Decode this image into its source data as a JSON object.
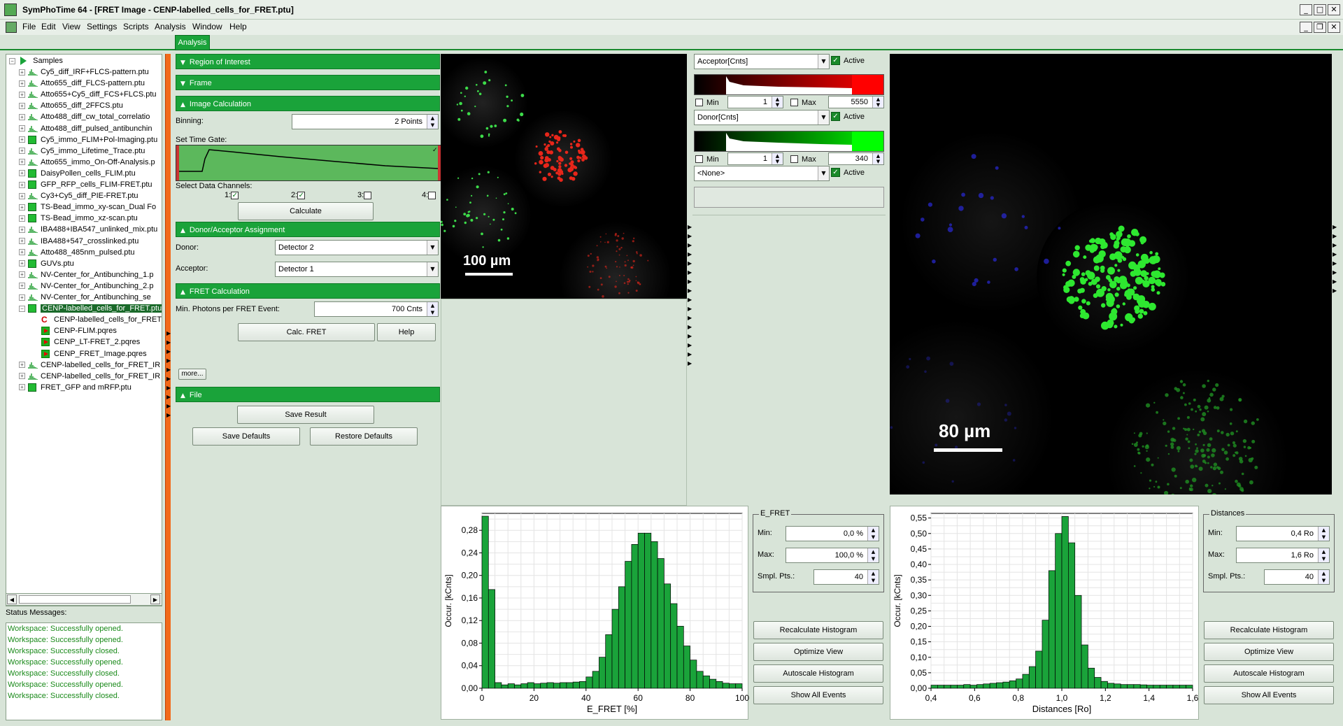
{
  "window": {
    "title": "SymPhoTime 64 - [FRET Image - CENP-labelled_cells_for_FRET.ptu]"
  },
  "menu": [
    "File",
    "Edit",
    "View",
    "Settings",
    "Scripts",
    "Analysis",
    "Window",
    "Help"
  ],
  "tabs": {
    "active": "Analysis"
  },
  "tree": {
    "root": "Samples",
    "items": [
      {
        "label": "Cy5_diff_IRF+FLCS-pattern.ptu",
        "icon": "bar"
      },
      {
        "label": "Atto655_diff_FLCS-pattern.ptu",
        "icon": "bar"
      },
      {
        "label": "Atto655+Cy5_diff_FCS+FLCS.ptu",
        "icon": "bar"
      },
      {
        "label": "Atto655_diff_2FFCS.ptu",
        "icon": "bar"
      },
      {
        "label": "Atto488_diff_cw_total_correlatio",
        "icon": "bar"
      },
      {
        "label": "Atto488_diff_pulsed_antibunchin",
        "icon": "bar"
      },
      {
        "label": "Cy5_immo_FLIM+Pol-Imaging.ptu",
        "icon": "square"
      },
      {
        "label": "Cy5_immo_Lifetime_Trace.ptu",
        "icon": "bar"
      },
      {
        "label": "Atto655_immo_On-Off-Analysis.p",
        "icon": "bar"
      },
      {
        "label": "DaisyPollen_cells_FLIM.ptu",
        "icon": "square"
      },
      {
        "label": "GFP_RFP_cells_FLIM-FRET.ptu",
        "icon": "square"
      },
      {
        "label": "Cy3+Cy5_diff_PIE-FRET.ptu",
        "icon": "bar"
      },
      {
        "label": "TS-Bead_immo_xy-scan_Dual Fo",
        "icon": "square"
      },
      {
        "label": "TS-Bead_immo_xz-scan.ptu",
        "icon": "square"
      },
      {
        "label": "IBA488+IBA547_unlinked_mix.ptu",
        "icon": "bar"
      },
      {
        "label": "IBA488+547_crosslinked.ptu",
        "icon": "bar"
      },
      {
        "label": "Atto488_485nm_pulsed.ptu",
        "icon": "bar"
      },
      {
        "label": "GUVs.ptu",
        "icon": "square"
      },
      {
        "label": "NV-Center_for_Antibunching_1.p",
        "icon": "bar"
      },
      {
        "label": "NV-Center_for_Antibunching_2.p",
        "icon": "bar"
      },
      {
        "label": "NV-Center_for_Antibunching_se",
        "icon": "bar"
      },
      {
        "label": "CENP-labelled_cells_for_FRET.ptu",
        "icon": "square",
        "selected": true
      },
      {
        "label": "CENP-labelled_cells_for_FRET",
        "icon": "c",
        "child": true
      },
      {
        "label": "CENP-FLIM.pqres",
        "icon": "pq",
        "child": true
      },
      {
        "label": "CENP_LT-FRET_2.pqres",
        "icon": "pq",
        "child": true
      },
      {
        "label": "CENP_FRET_Image.pqres",
        "icon": "pq",
        "child": true
      },
      {
        "label": "CENP-labelled_cells_for_FRET_IR",
        "icon": "bar"
      },
      {
        "label": "CENP-labelled_cells_for_FRET_IR",
        "icon": "bar"
      },
      {
        "label": "FRET_GFP and mRFP.ptu",
        "icon": "square"
      }
    ]
  },
  "status": {
    "label": "Status Messages:",
    "messages": [
      "Workspace: Successfully opened.",
      "Workspace: Successfully opened.",
      "Workspace: Successfully closed.",
      "Workspace: Successfully opened.",
      "Workspace: Successfully closed.",
      "Workspace: Successfully opened.",
      "Workspace: Successfully closed."
    ]
  },
  "panel": {
    "sec_roi": "Region of Interest",
    "sec_frame": "Frame",
    "sec_imgcalc": "Image Calculation",
    "binning_label": "Binning:",
    "binning_value": "2 Points",
    "timegate_label": "Set Time Gate:",
    "channels_label": "Select Data Channels:",
    "channels": [
      {
        "label": "1:",
        "checked": true
      },
      {
        "label": "2:",
        "checked": true
      },
      {
        "label": "3:",
        "checked": false
      },
      {
        "label": "4:",
        "checked": false
      }
    ],
    "calculate": "Calculate",
    "sec_da": "Donor/Acceptor Assignment",
    "donor_label": "Donor:",
    "donor_value": "Detector 2",
    "acceptor_label": "Acceptor:",
    "acceptor_value": "Detector 1",
    "sec_fret": "FRET Calculation",
    "minphot_label": "Min. Photons per FRET Event:",
    "minphot_value": "700 Cnts",
    "calc_fret": "Calc. FRET",
    "help": "Help",
    "more": "more...",
    "sec_file": "File",
    "save_result": "Save Result",
    "save_defaults": "Save Defaults",
    "restore_defaults": "Restore Defaults"
  },
  "image1": {
    "scalebar": "100 µm"
  },
  "image2": {
    "scalebar": "80 µm"
  },
  "lut": {
    "acceptor": {
      "channel": "Acceptor[Cnts]",
      "active": "Active",
      "min_label": "Min",
      "min_value": "1",
      "max_label": "Max",
      "max_value": "5550",
      "color": "#ff0000"
    },
    "donor": {
      "channel": "Donor[Cnts]",
      "active": "Active",
      "min_label": "Min",
      "min_value": "1",
      "max_label": "Max",
      "max_value": "340",
      "color": "#00ff00"
    },
    "third": {
      "channel": "<None>",
      "active": "Active"
    }
  },
  "fret_hist": {
    "group": "E_FRET",
    "min_label": "Min:",
    "min_value": "0,0 %",
    "max_label": "Max:",
    "max_value": "100,0 %",
    "pts_label": "Smpl. Pts.:",
    "pts_value": "40",
    "buttons": [
      "Recalculate Histogram",
      "Optimize View",
      "Autoscale Histogram",
      "Show All Events"
    ]
  },
  "dist_hist": {
    "group": "Distances",
    "min_label": "Min:",
    "min_value": "0,4 Ro",
    "max_label": "Max:",
    "max_value": "1,6 Ro",
    "pts_label": "Smpl. Pts.:",
    "pts_value": "40",
    "buttons": [
      "Recalculate Histogram",
      "Optimize View",
      "Autoscale Histogram",
      "Show All Events"
    ]
  },
  "chart_data": [
    {
      "type": "bar",
      "xlabel": "E_FRET [%]",
      "ylabel": "Occur. [kCnts]",
      "xlim": [
        0,
        100
      ],
      "ylim": [
        0,
        0.31
      ],
      "xticks": [
        "0",
        "20",
        "40",
        "60",
        "80",
        "100"
      ],
      "yticks": [
        "0,00",
        "0,04",
        "0,08",
        "0,12",
        "0,16",
        "0,20",
        "0,24",
        "0,28"
      ],
      "bar_width": 2.5,
      "x": [
        0,
        2.5,
        5,
        7.5,
        10,
        12.5,
        15,
        17.5,
        20,
        22.5,
        25,
        27.5,
        30,
        32.5,
        35,
        37.5,
        40,
        42.5,
        45,
        47.5,
        50,
        52.5,
        55,
        57.5,
        60,
        62.5,
        65,
        67.5,
        70,
        72.5,
        75,
        77.5,
        80,
        82.5,
        85,
        87.5,
        90,
        92.5,
        95,
        97.5
      ],
      "values": [
        0.305,
        0.175,
        0.01,
        0.006,
        0.008,
        0.006,
        0.008,
        0.01,
        0.008,
        0.009,
        0.01,
        0.009,
        0.01,
        0.01,
        0.011,
        0.012,
        0.02,
        0.03,
        0.055,
        0.095,
        0.14,
        0.18,
        0.225,
        0.255,
        0.275,
        0.275,
        0.26,
        0.23,
        0.185,
        0.15,
        0.11,
        0.075,
        0.05,
        0.03,
        0.022,
        0.016,
        0.012,
        0.009,
        0.008,
        0.008
      ],
      "color": "#1aa33a"
    },
    {
      "type": "bar",
      "xlabel": "Distances [Ro]",
      "ylabel": "Occur. [kCnts]",
      "xlim": [
        0.4,
        1.6
      ],
      "ylim": [
        0,
        0.565
      ],
      "xticks": [
        "0,4",
        "0,6",
        "0,8",
        "1,0",
        "1,2",
        "1,4",
        "1,6"
      ],
      "yticks": [
        "0,00",
        "0,05",
        "0,10",
        "0,15",
        "0,20",
        "0,25",
        "0,30",
        "0,35",
        "0,40",
        "0,45",
        "0,50",
        "0,55"
      ],
      "bar_width": 0.03,
      "x": [
        0.4,
        0.43,
        0.46,
        0.49,
        0.52,
        0.55,
        0.58,
        0.61,
        0.64,
        0.67,
        0.7,
        0.73,
        0.76,
        0.79,
        0.82,
        0.85,
        0.88,
        0.91,
        0.94,
        0.97,
        1.0,
        1.03,
        1.06,
        1.09,
        1.12,
        1.15,
        1.18,
        1.21,
        1.24,
        1.27,
        1.3,
        1.33,
        1.36,
        1.39,
        1.42,
        1.45,
        1.48,
        1.51,
        1.54,
        1.57
      ],
      "values": [
        0.01,
        0.01,
        0.01,
        0.01,
        0.01,
        0.012,
        0.01,
        0.012,
        0.014,
        0.016,
        0.018,
        0.02,
        0.024,
        0.03,
        0.045,
        0.07,
        0.12,
        0.22,
        0.38,
        0.5,
        0.555,
        0.47,
        0.3,
        0.14,
        0.065,
        0.035,
        0.022,
        0.016,
        0.014,
        0.012,
        0.012,
        0.012,
        0.011,
        0.01,
        0.01,
        0.01,
        0.01,
        0.01,
        0.01,
        0.01
      ],
      "color": "#1aa33a"
    }
  ]
}
